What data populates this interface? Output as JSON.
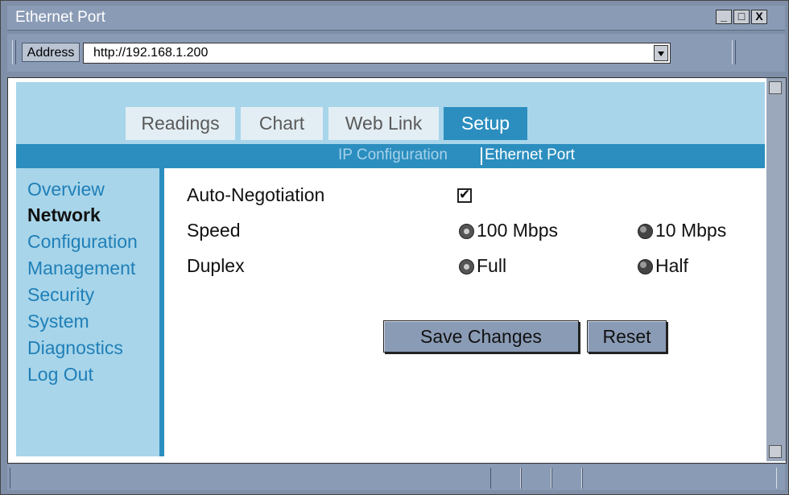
{
  "window": {
    "title": "Ethernet Port",
    "controls": [
      "_",
      "□",
      "X"
    ]
  },
  "address": {
    "label": "Address",
    "url": "http://192.168.1.200"
  },
  "tabs": [
    {
      "label": "Readings",
      "active": false
    },
    {
      "label": "Chart",
      "active": false
    },
    {
      "label": "Web Link",
      "active": false
    },
    {
      "label": "Setup",
      "active": true
    }
  ],
  "subnav": {
    "ip_config": "IP Configuration",
    "ethernet_port": "Ethernet Port"
  },
  "sidebar": {
    "items": [
      {
        "label": "Overview",
        "current": false
      },
      {
        "label": "Network",
        "current": true
      },
      {
        "label": "Configuration",
        "current": false
      },
      {
        "label": "Management",
        "current": false
      },
      {
        "label": "Security",
        "current": false
      },
      {
        "label": "System",
        "current": false
      },
      {
        "label": "Diagnostics",
        "current": false
      },
      {
        "label": "Log Out",
        "current": false
      }
    ]
  },
  "form": {
    "auto_negotiation": {
      "label": "Auto-Negotiation",
      "checked": true
    },
    "speed": {
      "label": "Speed",
      "options": [
        "100 Mbps",
        "10 Mbps"
      ],
      "selected": "100 Mbps"
    },
    "duplex": {
      "label": "Duplex",
      "options": [
        "Full",
        "Half"
      ],
      "selected": "Full"
    },
    "save_label": "Save Changes",
    "reset_label": "Reset"
  },
  "colors": {
    "accent": "#2b8ebf",
    "band": "#a8d5ea",
    "chrome": "#8a9bb5"
  }
}
